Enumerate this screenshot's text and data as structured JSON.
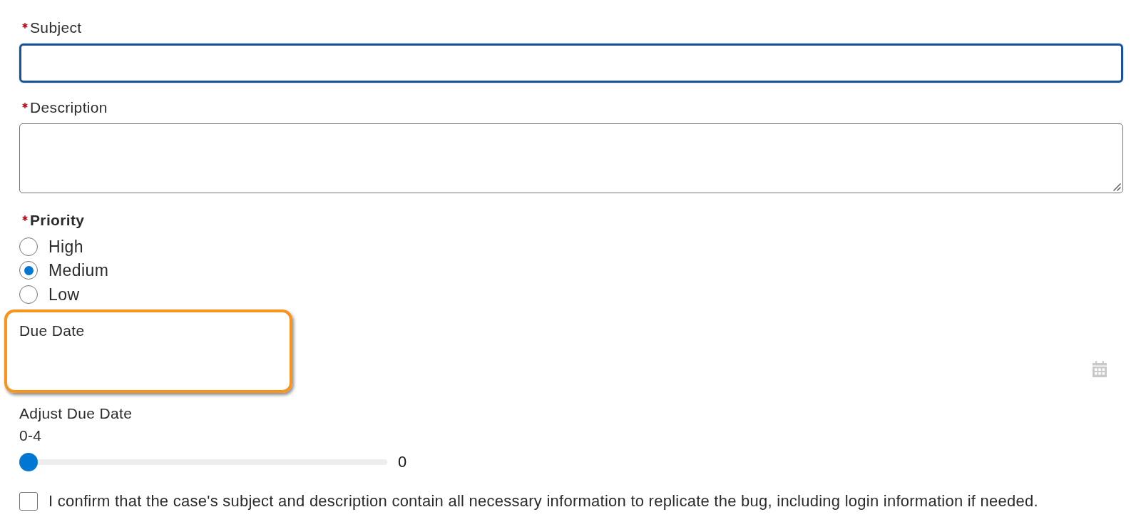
{
  "fields": [
    {
      "kind": "text",
      "label": "Subject",
      "required": true,
      "focused": true
    },
    {
      "kind": "textarea",
      "label": "Description",
      "required": true,
      "focused": false
    },
    {
      "kind": "radio_group",
      "label": "Priority",
      "required": true,
      "options": [
        {
          "label": "High",
          "selected": false
        },
        {
          "label": "Medium",
          "selected": true
        },
        {
          "label": "Low",
          "selected": false
        }
      ]
    },
    {
      "kind": "date",
      "label": "Due Date",
      "required": false,
      "highlighted": true
    },
    {
      "kind": "slider",
      "label": "Adjust Due Date",
      "required": false,
      "range": "0-4",
      "level": 0,
      "reading": "0"
    },
    {
      "kind": "checkbox",
      "label": "I confirm that the case's subject and description contain all necessary information to replicate the bug, including login information if needed.",
      "required": false,
      "checked": false
    }
  ]
}
